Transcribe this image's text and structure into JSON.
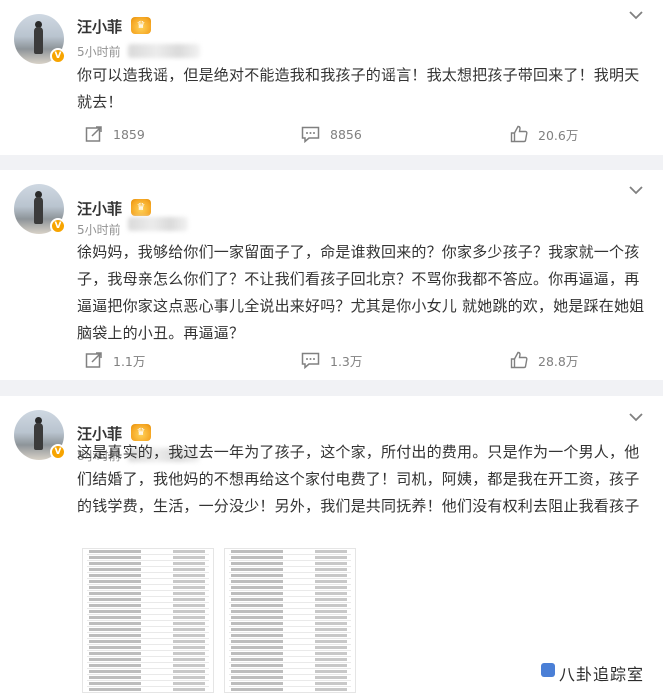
{
  "posts": [
    {
      "author": "汪小菲",
      "time": "5小时前",
      "body": "你可以造我谣，但是绝对不能造我和我孩子的谣言！我太想把孩子带回来了！我明天就去！",
      "repost_count": "1859",
      "comment_count": "8856",
      "like_count": "20.6万"
    },
    {
      "author": "汪小菲",
      "time": "5小时前",
      "body": "徐妈妈，我够给你们一家留面子了，命是谁救回来的？你家多少孩子？我家就一个孩子，我母亲怎么你们了？不让我们看孩子回北京？不骂你我都不答应。你再逼逼，再逼逼把你家这点恶心事儿全说出来好吗？尤其是你小女儿 就她跳的欢，她是踩在她姐脑袋上的小丑。再逼逼？",
      "repost_count": "1.1万",
      "comment_count": "1.3万",
      "like_count": "28.8万"
    },
    {
      "author": "汪小菲",
      "time": "8小时前",
      "body": "这是真实的，我过去一年为了孩子，这个家，所付出的费用。只是作为一个男人，他们结婚了，我他妈的不想再给这个家付电费了！司机，阿姨，都是我在开工资，孩子的钱学费，生活，一分没少！另外，我们是共同抚养！他们没有权利去阻止我看孩子"
    }
  ],
  "verified_badge": "V",
  "watermark": "八卦追踪室",
  "icons": {
    "more": "chevron-down-icon",
    "repost": "repost-icon",
    "comment": "comment-icon",
    "like": "thumbs-up-icon",
    "crown": "crown-icon"
  },
  "colors": {
    "page_bg": "#f1f2f5",
    "text": "#333333",
    "meta": "#939393",
    "badge": "#f7a400"
  }
}
